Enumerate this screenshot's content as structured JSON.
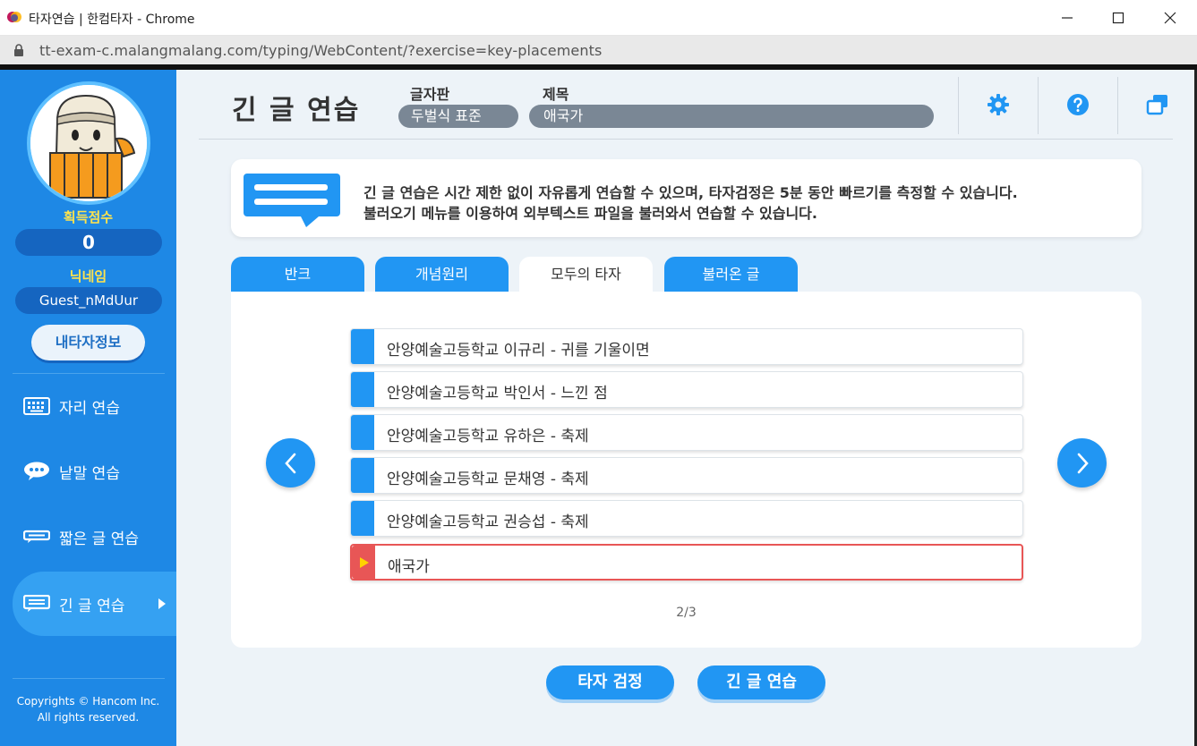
{
  "window": {
    "title": "타자연습 | 한컴타자 - Chrome",
    "url": "tt-exam-c.malangmalang.com/typing/WebContent/?exercise=key-placements"
  },
  "sidebar": {
    "score_label": "획득점수",
    "score_value": "0",
    "nickname_label": "닉네임",
    "nickname_value": "Guest_nMdUur",
    "my_info_button": "내타자정보",
    "nav": [
      {
        "label": "자리 연습",
        "icon": "keyboard-icon",
        "active": false
      },
      {
        "label": "낱말 연습",
        "icon": "speech-bubble-icon",
        "active": false
      },
      {
        "label": "짧은 글 연습",
        "icon": "short-text-icon",
        "active": false
      },
      {
        "label": "긴 글 연습",
        "icon": "long-text-icon",
        "active": true
      }
    ],
    "copyright_line1": "Copyrights © Hancom Inc.",
    "copyright_line2": "All rights reserved."
  },
  "header": {
    "title": "긴 글 연습",
    "keyboard_label": "글자판",
    "keyboard_value": "두벌식 표준",
    "subject_label": "제목",
    "subject_value": "애국가",
    "tools": [
      "gear-icon",
      "help-icon",
      "window-icon"
    ]
  },
  "notice": {
    "line1": "긴 글 연습은 시간 제한 없이 자유롭게 연습할 수 있으며, 타자검정은 5분 동안 빠르기를 측정할 수 있습니다.",
    "line2": "불러오기 메뉴를 이용하여 외부텍스트 파일을 불러와서 연습할 수 있습니다."
  },
  "tabs": [
    {
      "label": "반크",
      "active": false
    },
    {
      "label": "개념원리",
      "active": false
    },
    {
      "label": "모두의 타자",
      "active": true
    },
    {
      "label": "불러온 글",
      "active": false
    }
  ],
  "list": {
    "items": [
      {
        "label": "안양예술고등학교 이규리 - 귀를 기울이면",
        "selected": false
      },
      {
        "label": "안양예술고등학교 박인서 - 느낀 점",
        "selected": false
      },
      {
        "label": "안양예술고등학교 유하은 - 축제",
        "selected": false
      },
      {
        "label": "안양예술고등학교 문채영 - 축제",
        "selected": false
      },
      {
        "label": "안양예술고등학교 권승섭 - 축제",
        "selected": false
      },
      {
        "label": "애국가",
        "selected": true
      }
    ],
    "page": "2/3"
  },
  "actions": {
    "exam_button": "타자 검정",
    "practice_button": "긴 글 연습"
  },
  "colors": {
    "primary": "#2196f3",
    "sidebar": "#1e88e5",
    "selected_border": "#e85656",
    "label_yellow": "#ffe34d"
  }
}
